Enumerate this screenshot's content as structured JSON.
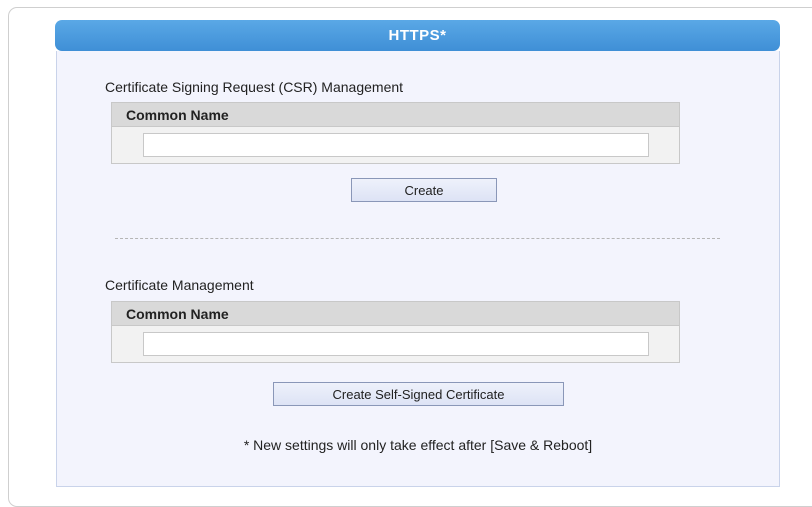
{
  "header": {
    "title": "HTTPS*"
  },
  "csr": {
    "section_title": "Certificate Signing Request (CSR) Management",
    "column_header": "Common Name",
    "input_value": "",
    "button_label": "Create"
  },
  "cert": {
    "section_title": "Certificate Management",
    "column_header": "Common Name",
    "input_value": "",
    "button_label": "Create Self-Signed Certificate"
  },
  "footer": {
    "note": "* New settings will only take effect after [Save & Reboot]"
  },
  "colors": {
    "title_bar": "#4a9be0",
    "panel_bg": "#f3f4fd",
    "table_header": "#d9d9d9"
  }
}
